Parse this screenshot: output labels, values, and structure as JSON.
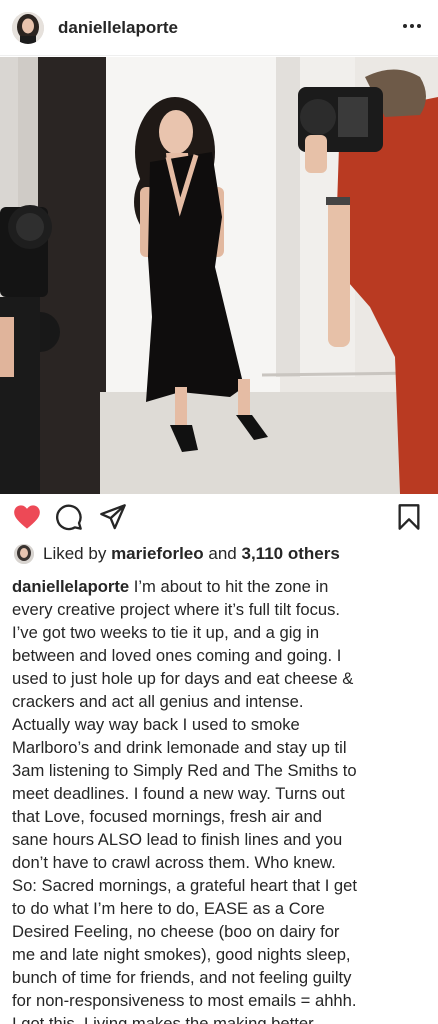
{
  "post": {
    "username": "daniellelaporte",
    "more_icon": "more-horizontal-icon"
  },
  "actions": {
    "like_icon": "heart-filled-icon",
    "like_color": "#ed4956",
    "comment_icon": "comment-icon",
    "share_icon": "share-icon",
    "save_icon": "bookmark-icon"
  },
  "likes": {
    "prefix": "Liked by",
    "liker": "marieforleo",
    "joiner": "and",
    "others": "3,110 others"
  },
  "caption": {
    "author": "daniellelaporte",
    "lines": [
      "I’m about to hit the zone in",
      "every creative project where it’s full tilt focus.",
      "I’ve got two weeks to tie it up, and a gig in",
      "between and loved ones coming and going. I",
      "used to just hole up for days and eat cheese &",
      "crackers and act all genius and intense.",
      "Actually way way back I used to smoke",
      "Marlboro’s and drink lemonade and stay up til",
      "3am listening to Simply Red and The Smiths to",
      "meet deadlines. I found a new way.  Turns out",
      "that Love,  focused mornings, fresh air and",
      "sane hours ALSO  lead to finish lines and you",
      "don’t have to crawl across them. Who knew.",
      "So: Sacred mornings, a grateful heart that I get",
      "to do what I’m here to do, EASE as a Core",
      "Desired Feeling, no cheese (boo on dairy for",
      "me and late night smokes), good nights sleep,",
      "bunch of time for friends, and not feeling guilty",
      "for non-responsiveness to most emails = ahhh.",
      "I got this. Living makes the making better."
    ]
  }
}
